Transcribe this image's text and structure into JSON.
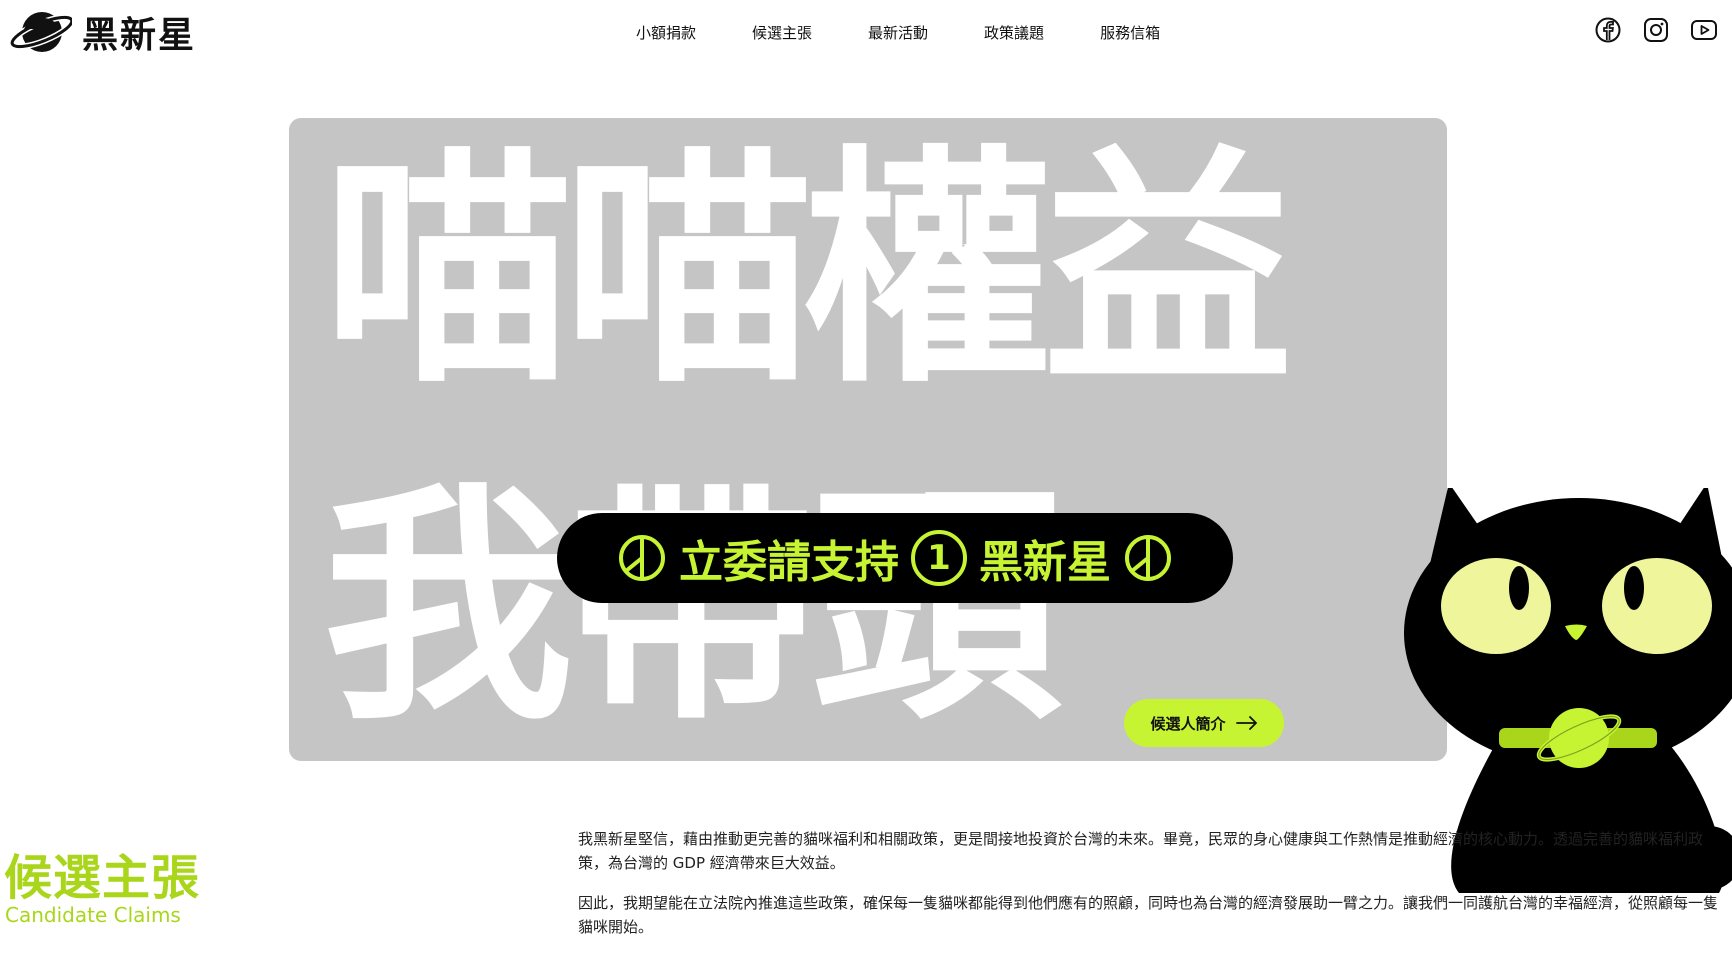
{
  "header": {
    "brand": "黑新星",
    "nav": [
      "小額捐款",
      "候選主張",
      "最新活動",
      "政策議題",
      "服務信箱"
    ],
    "social": [
      "facebook-icon",
      "instagram-icon",
      "youtube-icon"
    ]
  },
  "hero": {
    "headline_line1": "喵喵權益",
    "headline_line2": "我帶頭",
    "support_text_part1": "立委請支持",
    "support_number": "1",
    "support_text_part2": "黑新星",
    "intro_button": "候選人簡介"
  },
  "claims": {
    "title": "候選主張",
    "subtitle": "Candidate Claims",
    "paragraphs": [
      "我黑新星堅信，藉由推動更完善的貓咪福利和相關政策，更是間接地投資於台灣的未來。畢竟，民眾的身心健康與工作熱情是推動經濟的核心動力。透過完善的貓咪福利政策，為台灣的 GDP 經濟帶來巨大效益。",
      "因此，我期望能在立法院內推進這些政策，確保每一隻貓咪都能得到他們應有的照顧，同時也為台灣的經濟發展助一臂之力。讓我們一同護航台灣的幸福經濟，從照顧每一隻貓咪開始。"
    ]
  },
  "colors": {
    "accent": "#c6f432",
    "accent_text": "#a9d61a",
    "hero_bg": "#c5c5c5",
    "dark": "#000000"
  }
}
